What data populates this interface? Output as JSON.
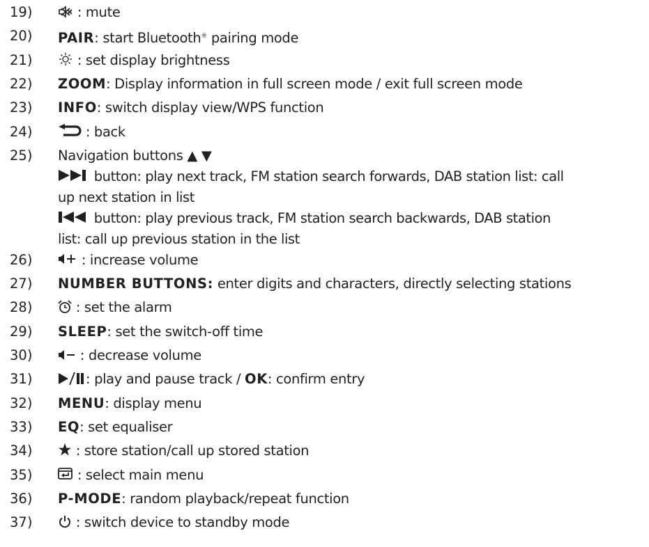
{
  "items": [
    {
      "num": "19)",
      "icon": "mute-icon",
      "kw": "",
      "text": " : mute"
    },
    {
      "num": "20)",
      "icon": "",
      "kw": "PAIR",
      "text": ": start Bluetooth",
      "sup": "®",
      "text2": " pairing mode"
    },
    {
      "num": "21)",
      "icon": "brightness-icon",
      "kw": "",
      "text": " : set display brightness"
    },
    {
      "num": "22)",
      "icon": "",
      "kw": "ZOOM",
      "text": ": Display information in full screen mode / exit full screen mode"
    },
    {
      "num": "23)",
      "icon": "",
      "kw": "INFO",
      "text": ": switch display view/WPS function"
    },
    {
      "num": "24)",
      "icon": "back-icon",
      "kw": "",
      "text": " : back"
    },
    {
      "num": "25)",
      "icon": "",
      "kw": "",
      "text": "Navigation buttons ▲ ▼"
    },
    {
      "num": "26)",
      "icon": "volume-up-icon",
      "kw": "",
      "text": " : increase volume"
    },
    {
      "num": "27)",
      "icon": "",
      "kw": "NUMBER BUTTONS:",
      "text": " enter digits and characters, directly selecting stations"
    },
    {
      "num": "28)",
      "icon": "alarm-icon",
      "kw": "",
      "text": " : set the alarm"
    },
    {
      "num": "29)",
      "icon": "",
      "kw": "SLEEP",
      "text": ": set the switch-off time"
    },
    {
      "num": "30)",
      "icon": "volume-down-icon",
      "kw": "",
      "text": " : decrease volume"
    },
    {
      "num": "31)",
      "icon": "play-pause-icon",
      "kw": "",
      "text": ": play and pause track / ",
      "kw2": "OK",
      "text2": ": confirm entry"
    },
    {
      "num": "32)",
      "icon": "",
      "kw": "MENU",
      "text": ": display menu"
    },
    {
      "num": "33)",
      "icon": "",
      "kw": "EQ",
      "text": ": set equaliser"
    },
    {
      "num": "34)",
      "icon": "star-icon",
      "kw": "",
      "text": " : store station/call up stored station"
    },
    {
      "num": "35)",
      "icon": "main-menu-icon",
      "kw": "",
      "text": " : select main menu"
    },
    {
      "num": "36)",
      "icon": "",
      "kw": "P-MODE",
      "text": ": random playback/repeat function"
    },
    {
      "num": "37)",
      "icon": "power-icon",
      "kw": "",
      "text": " : switch device to standby mode"
    }
  ],
  "nav_sub": {
    "next_line1": " button: play next track, FM station search forwards, DAB station list: call",
    "next_line2": "up next station in list",
    "prev_line1": " button: play previous track, FM station search backwards, DAB station",
    "prev_line2": "list: call up previous station in the list"
  }
}
